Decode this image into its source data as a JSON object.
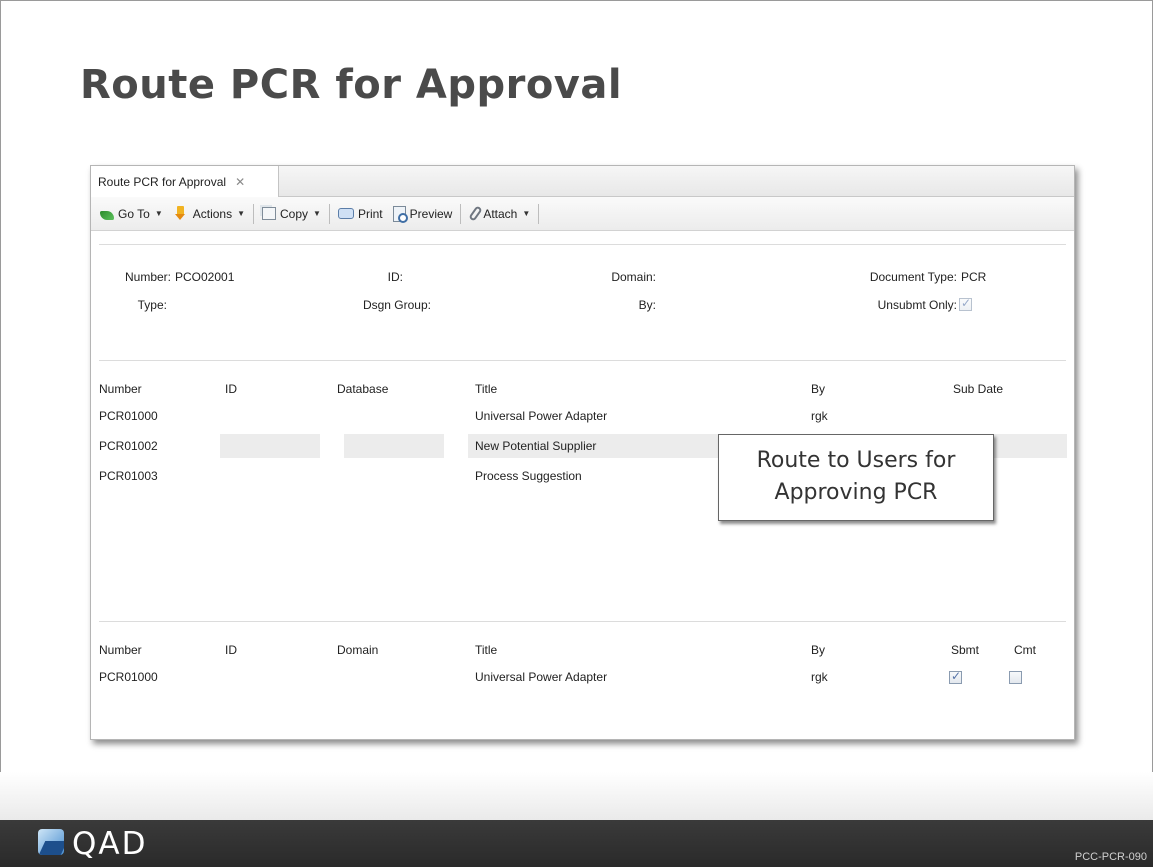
{
  "slide": {
    "title": "Route PCR for Approval",
    "code": "PCC-PCR-090",
    "logo_text": "QAD"
  },
  "tab": {
    "label": "Route PCR for Approval",
    "close_glyph": "✕"
  },
  "toolbar": {
    "goto": "Go To",
    "actions": "Actions",
    "copy": "Copy",
    "print": "Print",
    "preview": "Preview",
    "attach": "Attach"
  },
  "header": {
    "number_label": "Number:",
    "number_value": "PCO02001",
    "id_label": "ID:",
    "domain_label": "Domain:",
    "doctype_label": "Document Type:",
    "doctype_value": "PCR",
    "type_label": "Type:",
    "dsgn_group_label": "Dsgn Group:",
    "by_label": "By:",
    "unsubmt_label": "Unsubmt Only:",
    "unsubmt_checked": true
  },
  "list1": {
    "columns": [
      "Number",
      "ID",
      "Database",
      "Title",
      "By",
      "Sub Date"
    ],
    "rows": [
      {
        "number": "PCR01000",
        "id": "",
        "database": "",
        "title": "Universal Power Adapter",
        "by": "rgk",
        "sub_date": ""
      },
      {
        "number": "PCR01002",
        "id": "",
        "database": "",
        "title": "New Potential Supplier",
        "by": "",
        "sub_date": ""
      },
      {
        "number": "PCR01003",
        "id": "",
        "database": "",
        "title": "Process Suggestion",
        "by": "",
        "sub_date": ""
      }
    ]
  },
  "list2": {
    "columns": [
      "Number",
      "ID",
      "Domain",
      "Title",
      "By",
      "Sbmt",
      "Cmt"
    ],
    "rows": [
      {
        "number": "PCR01000",
        "id": "",
        "domain": "",
        "title": "Universal Power Adapter",
        "by": "rgk",
        "sbmt": true,
        "cmt": false
      }
    ]
  },
  "callout": {
    "line1": "Route to Users for",
    "line2": "Approving PCR"
  }
}
